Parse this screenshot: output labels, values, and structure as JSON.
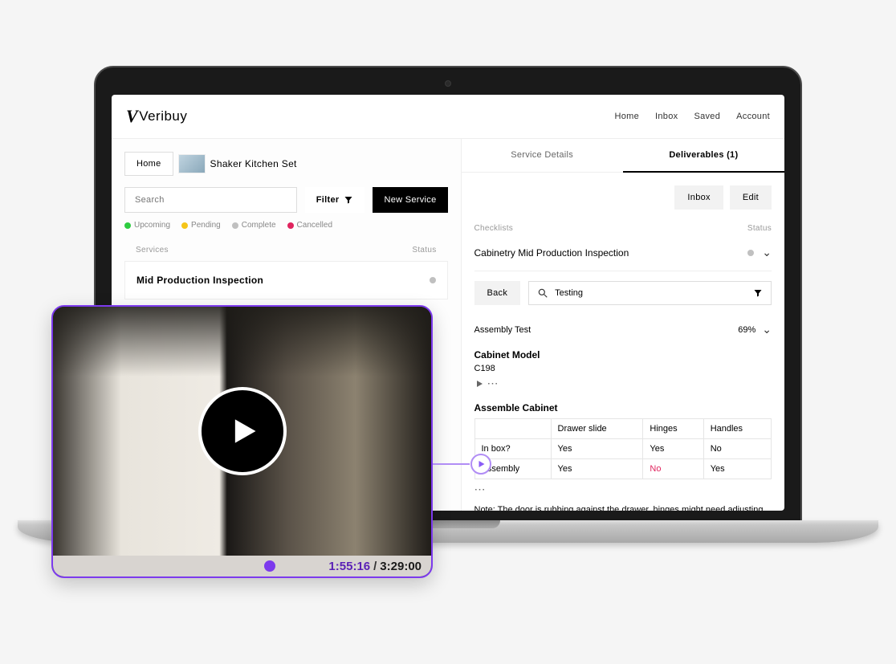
{
  "brand": "Veribuy",
  "nav": {
    "home": "Home",
    "inbox": "Inbox",
    "saved": "Saved",
    "account": "Account"
  },
  "breadcrumb": {
    "home": "Home",
    "product": "Shaker Kitchen Set"
  },
  "search": {
    "placeholder": "Search"
  },
  "toolbar": {
    "filter": "Filter",
    "new_service": "New Service"
  },
  "legend": {
    "upcoming": "Upcoming",
    "pending": "Pending",
    "complete": "Complete",
    "cancelled": "Cancelled"
  },
  "left_list": {
    "col_services": "Services",
    "col_status": "Status",
    "row0": "Mid Production Inspection"
  },
  "tabs": {
    "service_details": "Service Details",
    "deliverables": "Deliverables (1)"
  },
  "actions": {
    "inbox": "Inbox",
    "edit": "Edit"
  },
  "section": {
    "checklists": "Checklists",
    "status": "Status"
  },
  "checklist": {
    "title": "Cabinetry Mid Production Inspection"
  },
  "back": "Back",
  "filter_value": "Testing",
  "assembly_test": {
    "label": "Assembly Test",
    "pct": "69%"
  },
  "cabinet_model": {
    "label": "Cabinet Model",
    "value": "C198"
  },
  "assemble": {
    "label": "Assemble Cabinet"
  },
  "table": {
    "h_drawer": "Drawer slide",
    "h_hinges": "Hinges",
    "h_handles": "Handles",
    "r1_label": "In box?",
    "r1_drawer": "Yes",
    "r1_hinges": "Yes",
    "r1_handles": "No",
    "r2_label": "Assembly",
    "r2_drawer": "Yes",
    "r2_hinges": "No",
    "r2_handles": "Yes"
  },
  "note": "Note: The door is rubbing against the drawer, hinges might need adjusting",
  "video": {
    "current": "1:55:16",
    "total": "3:29:00",
    "sep": "/"
  }
}
